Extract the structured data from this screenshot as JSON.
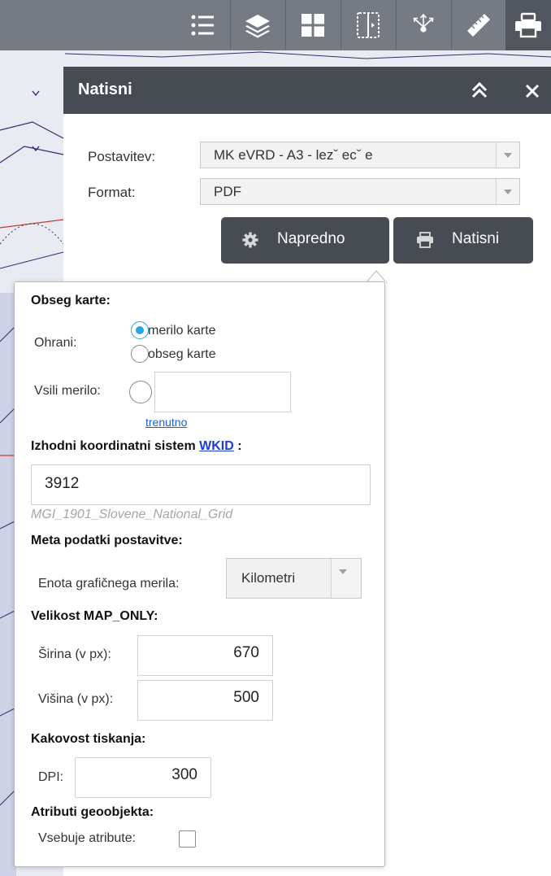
{
  "toolbar": {
    "tools": [
      {
        "name": "legend-tool",
        "icon": "list-icon"
      },
      {
        "name": "layers-tool",
        "icon": "layers-icon"
      },
      {
        "name": "basemap-tool",
        "icon": "grid-icon"
      },
      {
        "name": "swipe-tool",
        "icon": "swipe-icon"
      },
      {
        "name": "coordinate-tool",
        "icon": "xyz-axes-icon"
      },
      {
        "name": "measure-tool",
        "icon": "ruler-icon"
      },
      {
        "name": "print-tool",
        "icon": "printer-icon",
        "active": true
      }
    ],
    "bg_color": "#767a82",
    "active_color": "#52565e"
  },
  "widget": {
    "title": "Natisni",
    "collapse_icon": "chevron-double-up-icon",
    "close_icon": "close-icon",
    "postavitev_label": "Postavitev:",
    "postavitev_value": "MK eVRD - A3 - lezˇ ecˇ e",
    "format_label": "Format:",
    "format_value": "PDF",
    "advanced_button": "Napredno",
    "advanced_icon": "gear-icon",
    "print_button": "Natisni",
    "print_icon": "printer-icon",
    "header_color": "#474b52"
  },
  "advanced": {
    "map_extent": {
      "title": "Obseg karte:",
      "keep_label": "Ohrani:",
      "options": [
        "merilo karte",
        "obseg karte"
      ],
      "selected": 0,
      "force_scale_label": "Vsili merilo:",
      "scale_value": "",
      "current_link": "trenutno"
    },
    "coord_system": {
      "title_prefix": "Izhodni koordinatni sistem ",
      "title_link": "WKID",
      "title_suffix": " :",
      "wkid_value": "3912",
      "wkid_name": "MGI_1901_Slovene_National_Grid"
    },
    "layout_metadata": {
      "title": "Meta podatki postavitve:",
      "scale_unit_label": "Enota grafičnega merila:",
      "scale_unit_value": "Kilometri"
    },
    "map_only_size": {
      "title": "Velikost MAP_ONLY:",
      "width_label": "Širina (v px):",
      "width_value": "670",
      "height_label": "Višina (v px):",
      "height_value": "500"
    },
    "print_quality": {
      "title": "Kakovost tiskanja:",
      "dpi_label": "DPI:",
      "dpi_value": "300"
    },
    "feature_attributes": {
      "title": "Atributi geoobjekta:",
      "include_label": "Vsebuje atribute:",
      "checked": false
    },
    "accent_color": "#27a6df"
  }
}
